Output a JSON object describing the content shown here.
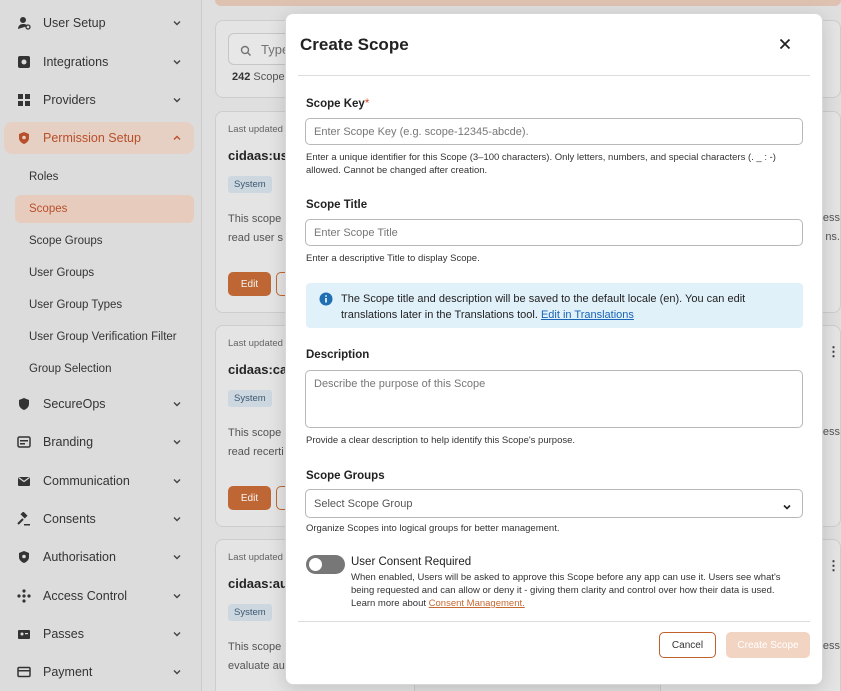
{
  "sidebar": {
    "items": [
      {
        "label": "User Setup",
        "icon": "user-gear-icon"
      },
      {
        "label": "Integrations",
        "icon": "integrations-icon"
      },
      {
        "label": "Providers",
        "icon": "providers-icon"
      },
      {
        "label": "Permission Setup",
        "icon": "permission-shield-icon"
      },
      {
        "label": "SecureOps",
        "icon": "shield-icon"
      },
      {
        "label": "Branding",
        "icon": "branding-icon"
      },
      {
        "label": "Communication",
        "icon": "mail-icon"
      },
      {
        "label": "Consents",
        "icon": "gavel-icon"
      },
      {
        "label": "Authorisation",
        "icon": "auth-shield-icon"
      },
      {
        "label": "Access Control",
        "icon": "access-control-icon"
      },
      {
        "label": "Passes",
        "icon": "passes-icon"
      },
      {
        "label": "Payment",
        "icon": "payment-card-icon"
      }
    ],
    "sub_items": [
      "Roles",
      "Scopes",
      "Scope Groups",
      "User Groups",
      "User Group Types",
      "User Group Verification Filter",
      "Group Selection"
    ]
  },
  "background": {
    "search_placeholder": "Type",
    "count_num": "242",
    "count_label": "Scope",
    "cards": [
      {
        "updated": "Last updated",
        "title": "cidaas:us",
        "badge": "System",
        "desc1": "This scope",
        "desc2": "read user s",
        "edit": "Edit"
      },
      {
        "updated": "Last updated",
        "title": "cidaas:ca",
        "badge": "System",
        "desc1": "This scope",
        "desc2": "read recerti",
        "edit": "Edit"
      },
      {
        "updated": "Last updated",
        "title": "cidaas:au",
        "badge": "System",
        "desc1": "This scope",
        "desc2": "evaluate au",
        "edit": "Edit"
      }
    ],
    "right_fragments": [
      "cess",
      "ns.",
      "cess",
      "cess"
    ]
  },
  "modal": {
    "title": "Create Scope",
    "scope_key": {
      "label": "Scope Key",
      "required_mark": "*",
      "placeholder": "Enter Scope Key (e.g. scope-12345-abcde).",
      "help": "Enter a unique identifier for this Scope (3–100 characters). Only letters, numbers, and special characters (. _ : -) allowed. Cannot be changed after creation."
    },
    "scope_title": {
      "label": "Scope Title",
      "placeholder": "Enter Scope Title",
      "help": "Enter a descriptive Title to display Scope."
    },
    "info": {
      "text": "The Scope title and description will be saved to the default locale (en). You can edit translations later in the Translations tool.",
      "link": "Edit in Translations"
    },
    "description": {
      "label": "Description",
      "placeholder": "Describe the purpose of this Scope",
      "help": "Provide a clear description to help identify this Scope's purpose."
    },
    "scope_groups": {
      "label": "Scope Groups",
      "placeholder": "Select Scope Group",
      "help": "Organize Scopes into logical groups for better management."
    },
    "consent": {
      "label": "User Consent Required",
      "desc": "When enabled, Users will be asked to approve this Scope before any app can use it. Users see what's being requested and can allow or deny it - giving them clarity and control over how their data is used. Learn more about",
      "link": "Consent Management."
    },
    "cancel_label": "Cancel",
    "create_label": "Create Scope"
  }
}
